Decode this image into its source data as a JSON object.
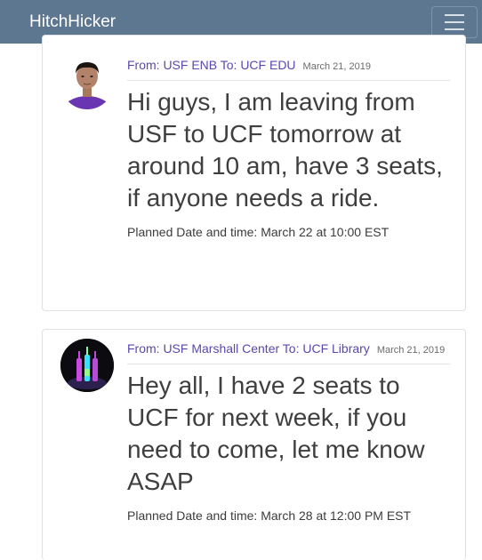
{
  "navbar": {
    "brand": "HitchHicker",
    "menu_icon": "hamburger-menu-icon"
  },
  "posts": [
    {
      "avatar_icon": "user-avatar-photo",
      "route": "From: USF ENB To: UCF EDU",
      "date": "March 21, 2019",
      "message": "Hi guys, I am leaving from USF to UCF tomorrow at around 10 am, have 3 seats, if anyone needs a ride.",
      "planned": "Planned Date and time: March 22 at 10:00 EST"
    },
    {
      "avatar_icon": "glowing-bottles-avatar",
      "route": "From: USF Marshall Center To: UCF Library",
      "date": "March 21, 2019",
      "message": "Hey all, I have 2 seats to UCF for next week, if you need to come, let me know ASAP",
      "planned": "Planned Date and time: March 28 at 12:00 PM EST"
    }
  ]
}
